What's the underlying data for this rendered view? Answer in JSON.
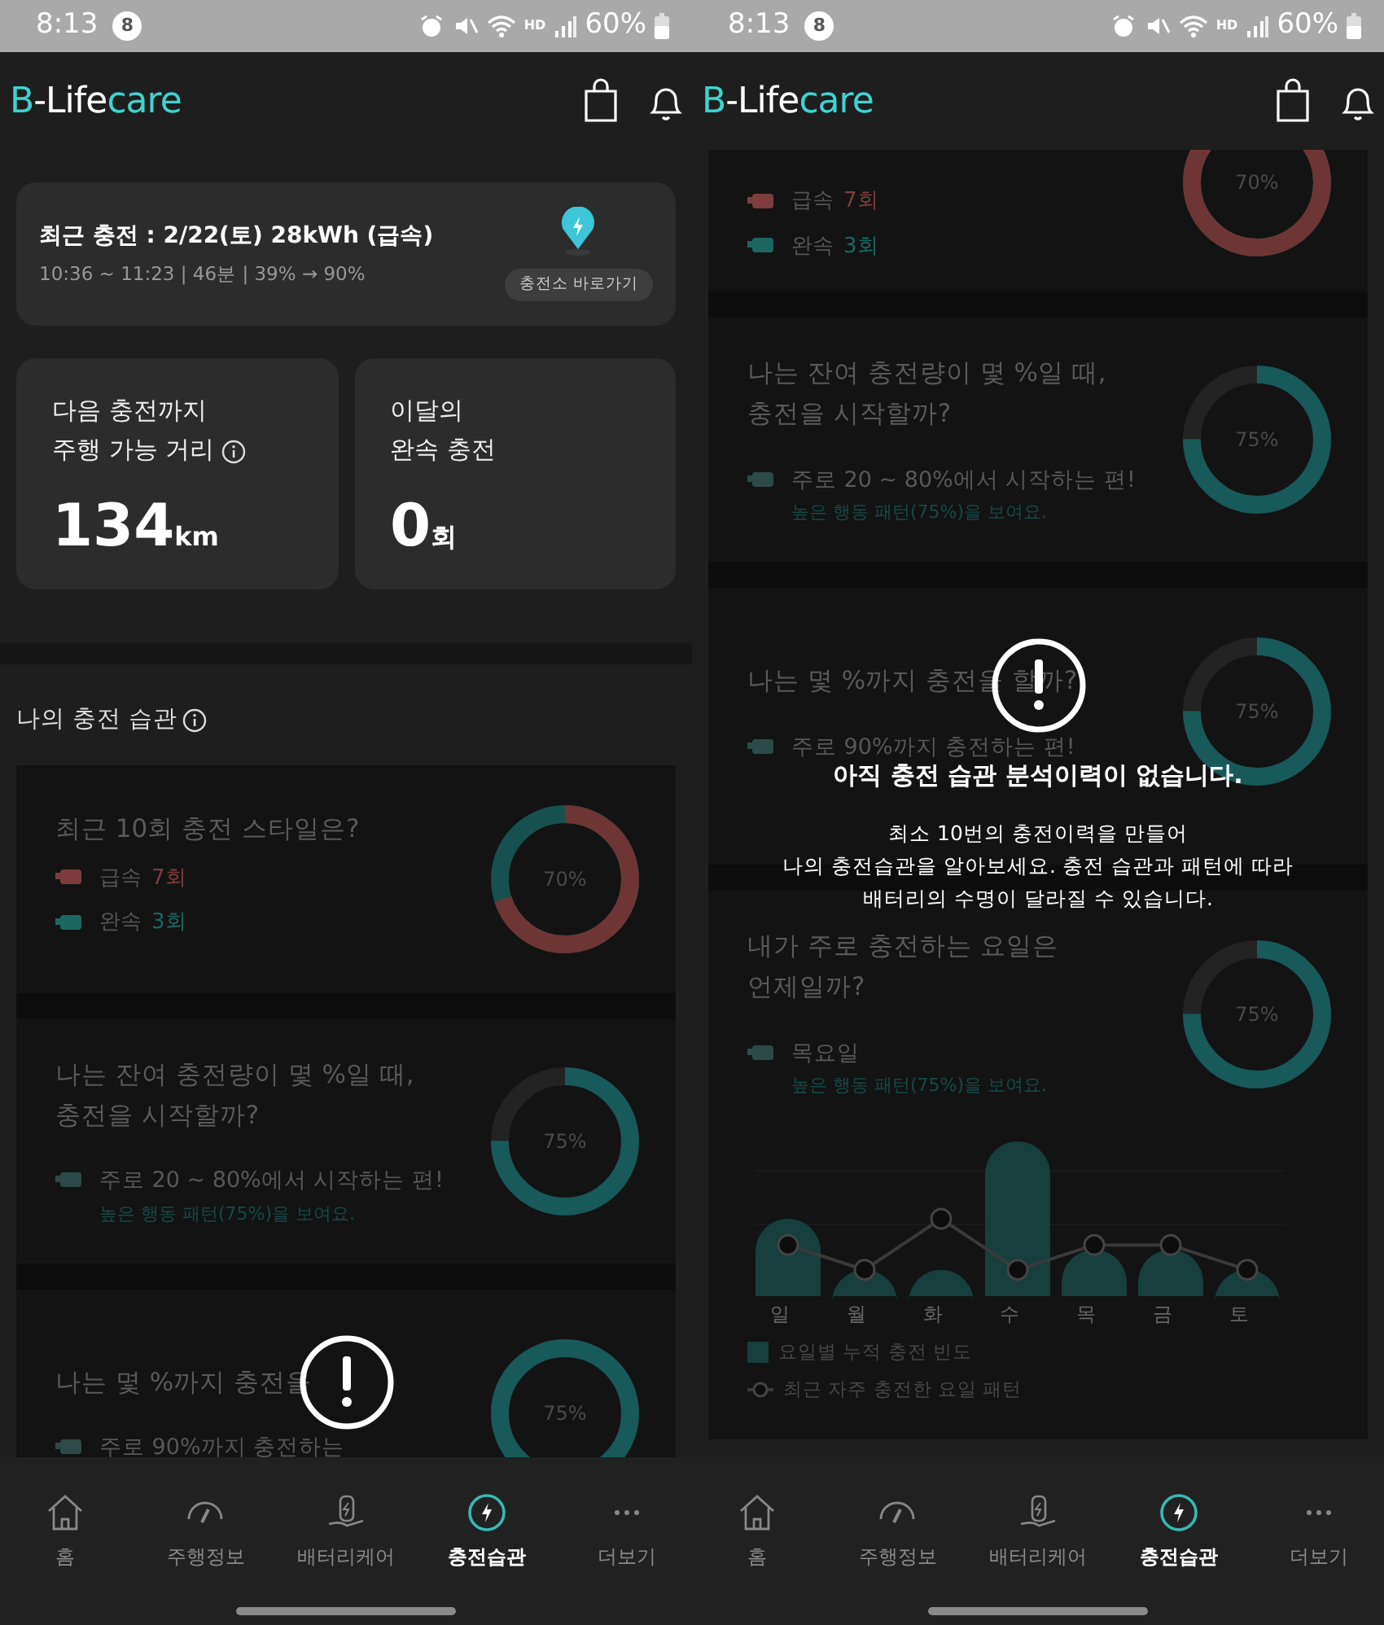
{
  "screens": [
    {
      "status_bar": {
        "time": "8:13",
        "badge": "8",
        "network": "HD",
        "battery": "60%"
      },
      "header": {
        "logo": [
          "B",
          "-Life",
          "care"
        ]
      },
      "recent_charge": {
        "title": "최근 충전 : 2/22(토) 28kWh (급속)",
        "detail": "10:36 ~ 11:23 | 46분 | 39% → 90%",
        "button": "충전소 바로가기"
      },
      "stats": [
        {
          "label": "다음 충전까지\n주행 가능 거리",
          "info": true,
          "value": "134",
          "unit": "km"
        },
        {
          "label": "이달의\n완속 충전",
          "info": false,
          "value": "0",
          "unit": "회"
        }
      ],
      "section_title": "나의 충전 습관",
      "habits": [
        {
          "kind": "split",
          "title": "최근 10회 충전 스타일은?",
          "legend": [
            {
              "label": "급속",
              "count": "7회",
              "color": "#7e3d3d"
            },
            {
              "label": "완속",
              "count": "3회",
              "color": "#1c6762"
            }
          ],
          "ring": {
            "level": 0.7,
            "label": "70%",
            "color": "#6e3535"
          }
        },
        {
          "kind": "pattern",
          "title": "나는 잔여 충전량이 몇 %일 때,\n충전을 시작할까?",
          "text": "주로 20 ~ 80%에서 시작하는 편!",
          "note": "높은 행동 패턴(75%)을 보여요.",
          "ring": {
            "level": 0.75,
            "label": "75%",
            "color": "#18595a"
          }
        },
        {
          "kind": "pattern",
          "title": "나는 몇 %까지 충전을",
          "text": "주로 90%까지 충전하는",
          "ring": {
            "label": "75%",
            "color": "#18595a"
          }
        }
      ],
      "alert": true,
      "nav": [
        {
          "label": "홈",
          "selected": false
        },
        {
          "label": "주행정보",
          "selected": false
        },
        {
          "label": "배터리케어",
          "selected": false
        },
        {
          "label": "충전습관",
          "selected": true
        },
        {
          "label": "더보기",
          "selected": false
        }
      ]
    },
    {
      "status_bar": {
        "time": "8:13",
        "badge": "8",
        "network": "HD",
        "battery": "60%"
      },
      "header": {
        "logo": [
          "B",
          "-Life",
          "care"
        ]
      },
      "habits": [
        {
          "kind": "split",
          "legend": [
            {
              "label": "급속",
              "count": "7회",
              "color": "#7e3d3d"
            },
            {
              "label": "완속",
              "count": "3회",
              "color": "#1c6762"
            }
          ],
          "ring": {
            "label": "70%",
            "color": "#6e3535"
          }
        },
        {
          "kind": "pattern",
          "title": "나는 잔여 충전량이 몇 %일 때,\n충전을 시작할까?",
          "text": "주로 20 ~ 80%에서 시작하는 편!",
          "note": "높은 행동 패턴(75%)을 보여요.",
          "ring": {
            "level": 0.75,
            "label": "75%",
            "color": "#18595a"
          }
        },
        {
          "kind": "pattern",
          "title": "나는 몇 %까지 충전을 할까?",
          "text": "주로 90%까지 충전하는 편!",
          "ring": {
            "level": 0.75,
            "label": "75%",
            "color": "#18595a"
          }
        },
        {
          "kind": "weekday",
          "title": "내가 주로 충전하는 요일은\n언제일까?",
          "text": "목요일",
          "note": "높은 행동 패턴(75%)을 보여요.",
          "ring": {
            "level": 0.75,
            "label": "75%",
            "color": "#18595a"
          },
          "days": [
            "일",
            "월",
            "화",
            "수",
            "목",
            "금",
            "토"
          ],
          "chart_legend": [
            "요일별 누적 충전 빈도",
            "최근 자주 충전한 요일 패턴"
          ]
        }
      ],
      "alert": true,
      "overlay": {
        "title": "아직 충전 습관 분석이력이 없습니다.",
        "body": "최소 10번의 충전이력을 만들어\n나의 충전습관을 알아보세요. 충전 습관과 패턴에 따라\n배터리의 수명이 달라질 수 있습니다."
      },
      "nav": [
        {
          "label": "홈",
          "selected": false
        },
        {
          "label": "주행정보",
          "selected": false
        },
        {
          "label": "배터리케어",
          "selected": false
        },
        {
          "label": "충전습관",
          "selected": true
        },
        {
          "label": "더보기",
          "selected": false
        }
      ]
    }
  ]
}
